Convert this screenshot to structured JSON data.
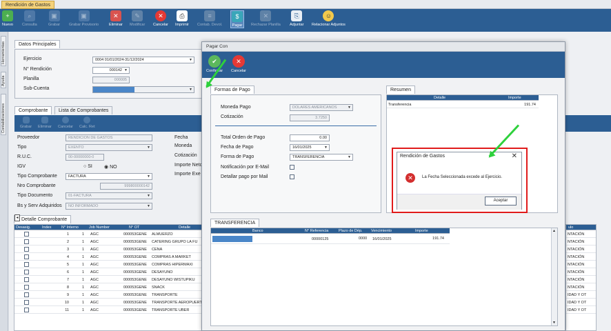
{
  "tab": {
    "title": "Rendición de Gastos"
  },
  "toolbar": {
    "items": [
      {
        "label": "Nuevo",
        "icon": "new-icon"
      },
      {
        "label": "Consulta",
        "icon": "query-icon"
      },
      {
        "label": "Grabar",
        "icon": "save-icon"
      },
      {
        "label": "Grabar Provisorio",
        "icon": "save-draft-icon"
      },
      {
        "label": "Eliminar",
        "icon": "delete-icon"
      },
      {
        "label": "Modificar",
        "icon": "edit-icon"
      },
      {
        "label": "Cancelar",
        "icon": "cancel-icon"
      },
      {
        "label": "Imprimir",
        "icon": "print-icon"
      },
      {
        "label": "Contab. Devol.",
        "icon": "accounting-icon"
      },
      {
        "label": "Pagar",
        "icon": "pay-icon"
      },
      {
        "label": "Rechazar Planilla",
        "icon": "reject-icon"
      },
      {
        "label": "Adjuntar",
        "icon": "attach-icon"
      },
      {
        "label": "Relacionar Adjuntos",
        "icon": "link-attachments-icon"
      }
    ]
  },
  "side_tabs": [
    "Herramientas",
    "Ayuda",
    "Contabilizaciones"
  ],
  "datos": {
    "tab": "Datos Principales",
    "ejercicio_label": "Ejercicio",
    "ejercicio_value": "0004 01/01/2024-31/12/2024",
    "rendicion_label": "N° Rendición",
    "rendicion_value": "000142",
    "planilla_label": "Planilla",
    "planilla_value": "000005",
    "subcuenta_label": "Sub-Cuenta"
  },
  "comprobante": {
    "tabs": [
      "Comprobante",
      "Lista de Comprobantes"
    ],
    "buttons": [
      "Grabar",
      "Eliminar",
      "Cancelar",
      "Calc. Ret"
    ],
    "proveedor_label": "Proveedor",
    "proveedor_value": "RENDICION DE GASTOS",
    "tipo_label": "Tipo",
    "tipo_value": "EXENTO",
    "ruc_label": "R.U.C.",
    "ruc_value": "00-00000000-0",
    "igv_label": "IGV",
    "igv_si": "SI",
    "igv_no": "NO",
    "tipocomp_label": "Tipo Comprobante",
    "tipocomp_value": "FACTURA",
    "nrocomp_label": "Nro Comprobante",
    "nrocomp_value": "999800000142",
    "tipodoc_label": "Tipo Documento",
    "tipodoc_value": "01-FACTURA",
    "bs_label": "Bs y Serv Adquiridos",
    "bs_value": "NO INFORMADO",
    "right_labels": [
      "Fecha",
      "Moneda",
      "Cotización",
      "Importe Neto",
      "Importe Exe"
    ]
  },
  "detalle": {
    "tab": "Detalle Comprobante",
    "headers": [
      "Desasig.",
      "Index",
      "N° Interno",
      "Job Number",
      "N° OT",
      "Detalle"
    ],
    "rows": [
      [
        "1",
        "1",
        "AGC",
        "000053GENE",
        "ALMUERZO"
      ],
      [
        "2",
        "1",
        "AGC",
        "000053GENE",
        "CATERING GRUPO LA FU"
      ],
      [
        "3",
        "1",
        "AGC",
        "000053GENE",
        "CENA"
      ],
      [
        "4",
        "1",
        "AGC",
        "000053GENE",
        "COMPRAS A MARKET"
      ],
      [
        "5",
        "1",
        "AGC",
        "000053GENE",
        "COMPRAS HIPERMAXI"
      ],
      [
        "6",
        "1",
        "AGC",
        "000053GENE",
        "DESAYUNO"
      ],
      [
        "7",
        "1",
        "AGC",
        "000053GENE",
        "DESAYUNO WISTUPIKU"
      ],
      [
        "8",
        "1",
        "AGC",
        "000053GENE",
        "SNACK"
      ],
      [
        "9",
        "1",
        "AGC",
        "000053GENE",
        "TRANSPORTE"
      ],
      [
        "10",
        "1",
        "AGC",
        "000053GENE",
        "TRANSPORTE AEROPUERT"
      ],
      [
        "11",
        "1",
        "AGC",
        "000053GENE",
        "TRANSPORTE UBER"
      ]
    ],
    "right_header": "ulo",
    "right_col": [
      "NTACIÓN",
      "NTACIÓN",
      "NTACIÓN",
      "NTACIÓN",
      "NTACIÓN",
      "NTACIÓN",
      "NTACIÓN",
      "NTACIÓN",
      "IDAD Y OT",
      "IDAD Y OT",
      "IDAD Y OT"
    ]
  },
  "pagar": {
    "title": "Pagar Con",
    "buttons": [
      {
        "label": "Confirmar",
        "icon": "confirm-icon"
      },
      {
        "label": "Cancelar",
        "icon": "cancel-icon"
      }
    ],
    "formas_tab": "Formas de Pago",
    "moneda_label": "Moneda Pago",
    "moneda_value": "DOLARES AMERICANOS",
    "cotizacion_label": "Cotización",
    "cotizacion_value": "3.7250",
    "total_label": "Total Orden de Pago",
    "total_value": "0.00",
    "fecha_label": "Fecha de Pago",
    "fecha_value": "16/01/2025",
    "forma_label": "Forma de Pago",
    "forma_value": "TRANSFERENCIA",
    "notif_label": "Notificación por E-Mail",
    "detallar_label": "Detallar pago por Mail",
    "resumen_tab": "Resumen",
    "resumen_headers": [
      "Detalle",
      "Importe"
    ],
    "resumen_row": [
      "Transferencia",
      "191.74"
    ],
    "transfer_tab": "TRANSFERENCIA",
    "transfer_headers": [
      "Banco",
      "N° Referencia",
      "Plazo de Dép.",
      "Vencimiento",
      "Importe"
    ],
    "transfer_row": [
      "",
      "00000125",
      "0000",
      "16/01/2025",
      "191.74"
    ]
  },
  "message": {
    "title": "Rendición de Gastos",
    "text": "La Fecha Seleccionada excede al Ejercicio.",
    "button": "Aceptar"
  },
  "colors": {
    "toolbar": "#2c5e93",
    "tab_active": "#f4d27a",
    "highlight": "#e01a1a",
    "arrow": "#2ed13c"
  }
}
